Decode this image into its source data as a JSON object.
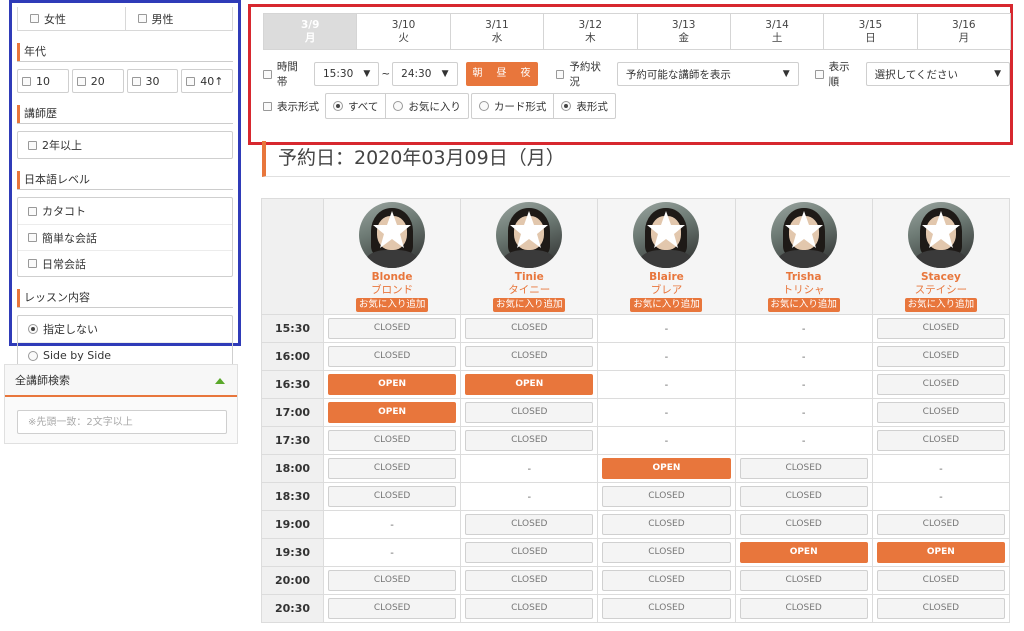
{
  "sidebar": {
    "gender": {
      "female": "女性",
      "male": "男性"
    },
    "age": {
      "title": "年代",
      "options": [
        "10",
        "20",
        "30",
        "40↑"
      ]
    },
    "experience": {
      "title": "講師歴",
      "options": [
        "2年以上"
      ]
    },
    "japanese": {
      "title": "日本語レベル",
      "options": [
        "カタコト",
        "簡単な会話",
        "日常会話"
      ]
    },
    "lesson": {
      "title": "レッスン内容",
      "options": [
        "指定しない",
        "Side by Side"
      ]
    },
    "search": {
      "title": "全講師検索",
      "placeholder": "※先頭一致：2文字以上"
    }
  },
  "filters": {
    "days": [
      {
        "date": "3/9",
        "weekday": "月"
      },
      {
        "date": "3/10",
        "weekday": "火"
      },
      {
        "date": "3/11",
        "weekday": "水"
      },
      {
        "date": "3/12",
        "weekday": "木"
      },
      {
        "date": "3/13",
        "weekday": "金"
      },
      {
        "date": "3/14",
        "weekday": "土"
      },
      {
        "date": "3/15",
        "weekday": "日"
      },
      {
        "date": "3/16",
        "weekday": "月"
      }
    ],
    "time_label": "時間帯",
    "time_from": "15:30",
    "tilde": "~",
    "time_to": "24:30",
    "tod": [
      "朝",
      "昼",
      "夜"
    ],
    "status_label": "予約状況",
    "status_value": "予約可能な講師を表示",
    "order_label": "表示順",
    "order_value": "選択してください",
    "display_label": "表示形式",
    "display_all": "すべて",
    "display_fav": "お気に入り",
    "view_card": "カード形式",
    "view_table": "表形式"
  },
  "date_heading": "予約日：2020年03月09日（月）",
  "schedule": {
    "teachers": [
      {
        "name": "Blonde",
        "kana": "ブロンド",
        "fav": "お気に入り追加"
      },
      {
        "name": "Tinie",
        "kana": "タイニー",
        "fav": "お気に入り追加"
      },
      {
        "name": "Blaire",
        "kana": "ブレア",
        "fav": "お気に入り追加"
      },
      {
        "name": "Trisha",
        "kana": "トリシャ",
        "fav": "お気に入り追加"
      },
      {
        "name": "Stacey",
        "kana": "ステイシー",
        "fav": "お気に入り追加"
      }
    ],
    "rows": [
      {
        "time": "15:30",
        "slots": [
          "CLOSED",
          "CLOSED",
          "-",
          "-",
          "CLOSED"
        ]
      },
      {
        "time": "16:00",
        "slots": [
          "CLOSED",
          "CLOSED",
          "-",
          "-",
          "CLOSED"
        ]
      },
      {
        "time": "16:30",
        "slots": [
          "OPEN",
          "OPEN",
          "-",
          "-",
          "CLOSED"
        ]
      },
      {
        "time": "17:00",
        "slots": [
          "OPEN",
          "CLOSED",
          "-",
          "-",
          "CLOSED"
        ]
      },
      {
        "time": "17:30",
        "slots": [
          "CLOSED",
          "CLOSED",
          "-",
          "-",
          "CLOSED"
        ]
      },
      {
        "time": "18:00",
        "slots": [
          "CLOSED",
          "-",
          "OPEN",
          "CLOSED",
          "-"
        ]
      },
      {
        "time": "18:30",
        "slots": [
          "CLOSED",
          "-",
          "CLOSED",
          "CLOSED",
          "-"
        ]
      },
      {
        "time": "19:00",
        "slots": [
          "-",
          "CLOSED",
          "CLOSED",
          "CLOSED",
          "CLOSED"
        ]
      },
      {
        "time": "19:30",
        "slots": [
          "-",
          "CLOSED",
          "CLOSED",
          "OPEN",
          "OPEN"
        ]
      },
      {
        "time": "20:00",
        "slots": [
          "CLOSED",
          "CLOSED",
          "CLOSED",
          "CLOSED",
          "CLOSED"
        ]
      },
      {
        "time": "20:30",
        "slots": [
          "CLOSED",
          "CLOSED",
          "CLOSED",
          "CLOSED",
          "CLOSED"
        ]
      }
    ]
  }
}
